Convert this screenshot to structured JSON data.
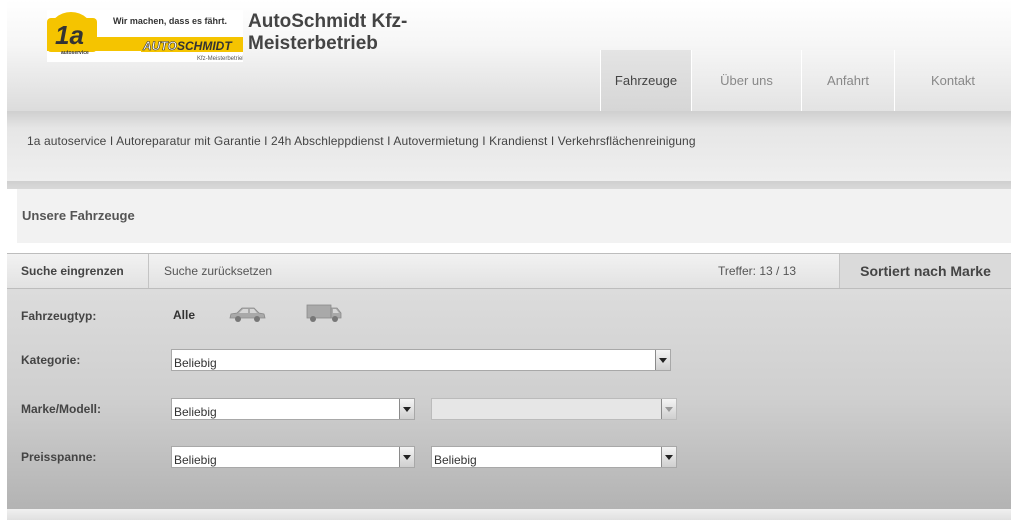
{
  "logo": {
    "number": "1a",
    "sub": "autoservice",
    "slogan": "Wir machen, dass es fährt.",
    "brand_left": "AUTO",
    "brand_right": "SCHMIDT",
    "brand_sub": "Kfz-Meisterbetrieb"
  },
  "site_title": "AutoSchmidt Kfz-Meisterbetrieb",
  "nav": {
    "items": [
      {
        "label": "Fahrzeuge"
      },
      {
        "label": "Über uns"
      },
      {
        "label": "Anfahrt"
      },
      {
        "label": "Kontakt"
      }
    ]
  },
  "tagline": "1a autoservice I Autoreparatur mit Garantie I 24h Abschleppdienst I Autovermietung I Krandienst I Verkehrsflächenreinigung",
  "section_title": "Unsere Fahrzeuge",
  "search": {
    "narrow_label": "Suche eingrenzen",
    "reset_label": "Suche zurücksetzen",
    "hits": "Treffer: 13 / 13",
    "sorted_label": "Sortiert nach Marke"
  },
  "filters": {
    "vehicle_type_label": "Fahrzeugtyp:",
    "vehicle_type_all": "Alle",
    "car_icon": "car-icon",
    "truck_icon": "van-icon",
    "category_label": "Kategorie:",
    "category_value": "Beliebig",
    "make_label": "Marke/Modell:",
    "make_value": "Beliebig",
    "model_value": "",
    "price_label": "Preisspanne:",
    "price_from": "Beliebig",
    "price_to": "Beliebig"
  },
  "colors": {
    "brand_yellow": "#f5c400",
    "brand_dark": "#333333"
  }
}
